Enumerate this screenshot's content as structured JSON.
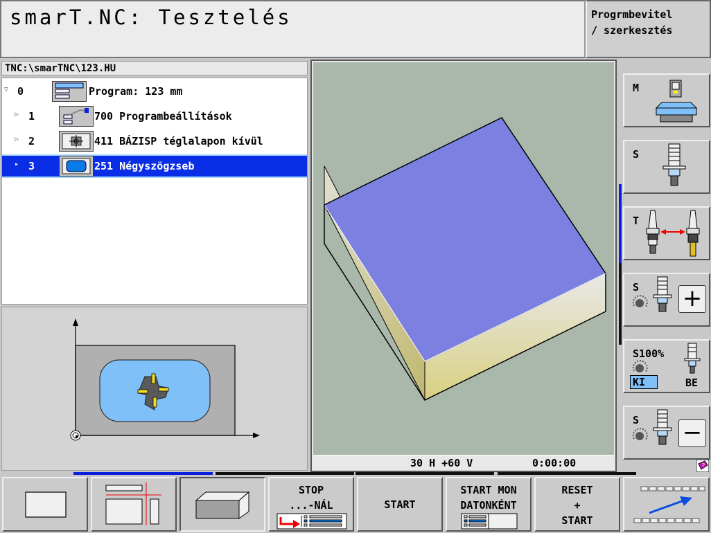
{
  "header": {
    "title": "smarT.NC: Tesztelés",
    "mode_line1": "Progrmbevitel",
    "mode_line2": "/ szerkesztés"
  },
  "program": {
    "path": "TNC:\\smarTNC\\123.HU",
    "tree": [
      {
        "num": "0",
        "label": "Program: 123 mm",
        "expanded": true,
        "selected": false,
        "icon": "program-icon"
      },
      {
        "num": "1",
        "label": "700 Programbeállítások",
        "expanded": false,
        "selected": false,
        "icon": "program-settings-icon"
      },
      {
        "num": "2",
        "label": "411 BÁZISP téglalapon kívül",
        "expanded": false,
        "selected": false,
        "icon": "datum-rectangle-icon"
      },
      {
        "num": "3",
        "label": "251 Négyszögzseb",
        "expanded": false,
        "selected": true,
        "icon": "rectangular-pocket-icon"
      }
    ]
  },
  "view": {
    "angles": "30 H +60 V",
    "time": "0:00:00"
  },
  "side_buttons": [
    {
      "label": "M",
      "icon": "machine-icon"
    },
    {
      "label": "S",
      "icon": "spindle-icon"
    },
    {
      "label": "T",
      "icon": "tool-change-icon"
    },
    {
      "label": "S",
      "icon": "spindle-override-plus-icon",
      "action": "+"
    },
    {
      "label": "S100%",
      "icon": "spindle-override-100-icon",
      "off": "KI",
      "on": "BE",
      "state": "KI"
    },
    {
      "label": "S",
      "icon": "spindle-override-minus-icon",
      "action": "−"
    }
  ],
  "softkeys": [
    {
      "icon": "plan-view-icon",
      "text": []
    },
    {
      "icon": "three-plane-view-icon",
      "text": []
    },
    {
      "icon": "3d-view-icon",
      "text": [],
      "pressed": true
    },
    {
      "icon": "stop-at-icon",
      "text": [
        "STOP",
        "...-NÁL"
      ]
    },
    {
      "icon": "",
      "text": [
        "START"
      ]
    },
    {
      "icon": "single-block-icon",
      "text": [
        "START MON",
        "DATONKÉNT"
      ]
    },
    {
      "icon": "",
      "text": [
        "RESET",
        "+",
        "START"
      ]
    },
    {
      "icon": "next-softkey-row-icon",
      "text": []
    }
  ],
  "colors": {
    "selection": "#0a2ee6",
    "accent_blue": "#0a1ee0",
    "workpiece_top": "#7c80e0",
    "view_bg": "#a9b8aa",
    "pocket": "#80c0f8"
  }
}
